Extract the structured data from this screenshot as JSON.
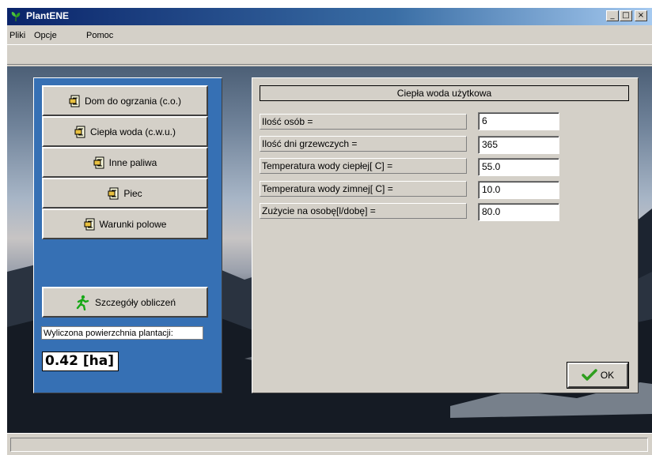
{
  "window": {
    "title": "PlantENE",
    "controls": [
      "_",
      "□",
      "×"
    ]
  },
  "menu": {
    "items": [
      "Pliki",
      "Opcje",
      "Pomoc"
    ]
  },
  "nav": {
    "buttons": [
      "Dom do ogrzania (c.o.)",
      "Ciepła woda (c.w.u.)",
      "Inne paliwa",
      "Piec",
      "Warunki polowe"
    ],
    "details_button": "Szczegóły obliczeń"
  },
  "result": {
    "label": "Wyliczona powierzchnia plantacji:",
    "value": "0.42 [ha]"
  },
  "form": {
    "title": "Ciepła woda użytkowa",
    "fields": [
      {
        "label": "Ilość osób =",
        "value": "6"
      },
      {
        "label": "Ilość dni grzewczych =",
        "value": "365"
      },
      {
        "label": "Temperatura wody ciepłej[ C] =",
        "value": "55.0"
      },
      {
        "label": "Temperatura wody zimnej[ C] =",
        "value": "10.0"
      },
      {
        "label": "Zużycie na osobę[l/dobę] =",
        "value": "80.0"
      }
    ],
    "ok_label": "OK"
  },
  "icons": {
    "app": "plant-icon",
    "nav": "document-icon",
    "details": "running-man-icon",
    "ok": "checkmark-icon"
  },
  "colors": {
    "nav_panel": "#3670b4",
    "title_bar": "#0a246a",
    "check": "#2e9e1e",
    "runner": "#17a817"
  }
}
